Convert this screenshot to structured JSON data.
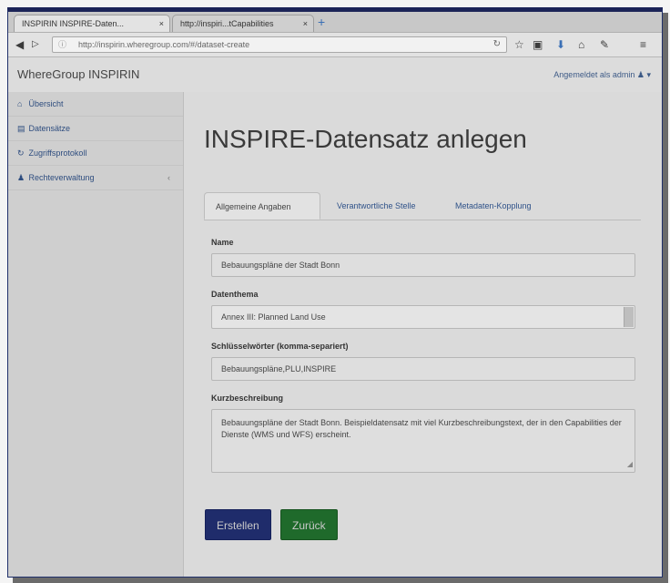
{
  "browser": {
    "tabs": [
      {
        "label": "INSPIRIN INSPIRE-Daten..."
      },
      {
        "label": "http://inspiri...tCapabilities"
      }
    ],
    "new_tab_icon": "plus-icon",
    "url": "http://inspirin.wheregroup.com/#/dataset-create"
  },
  "navbar": {
    "brand": "WhereGroup INSPIRIN",
    "user": "Angemeldet als admin"
  },
  "sidebar": {
    "items": [
      {
        "label": "Übersicht",
        "icon": "home-icon"
      },
      {
        "label": "Datensätze",
        "icon": "database-icon"
      },
      {
        "label": "Zugriffsprotokoll",
        "icon": "log-icon"
      },
      {
        "label": "Rechteverwaltung",
        "icon": "users-icon"
      }
    ]
  },
  "main": {
    "title": "INSPIRE-Datensatz anlegen",
    "tabs": [
      {
        "label": "Allgemeine Angaben"
      },
      {
        "label": "Verantwortliche Stelle"
      },
      {
        "label": "Metadaten-Kopplung"
      }
    ],
    "form": {
      "name_label": "Name",
      "name_value": "Bebauungspläne der Stadt Bonn",
      "theme_label": "Datenthema",
      "theme_value": "Annex III: Planned Land Use",
      "keywords_label": "Schlüsselwörter (komma-separiert)",
      "keywords_value": "Bebauungspläne,PLU,INSPIRE",
      "abstract_label": "Kurzbeschreibung",
      "abstract_value": "Bebauungspläne der Stadt Bonn. Beispieldatensatz mit viel Kurzbeschreibungstext, der in den Capabilities der Dienste (WMS und WFS) erscheint."
    },
    "buttons": {
      "create": "Erstellen",
      "back": "Zurück"
    }
  }
}
